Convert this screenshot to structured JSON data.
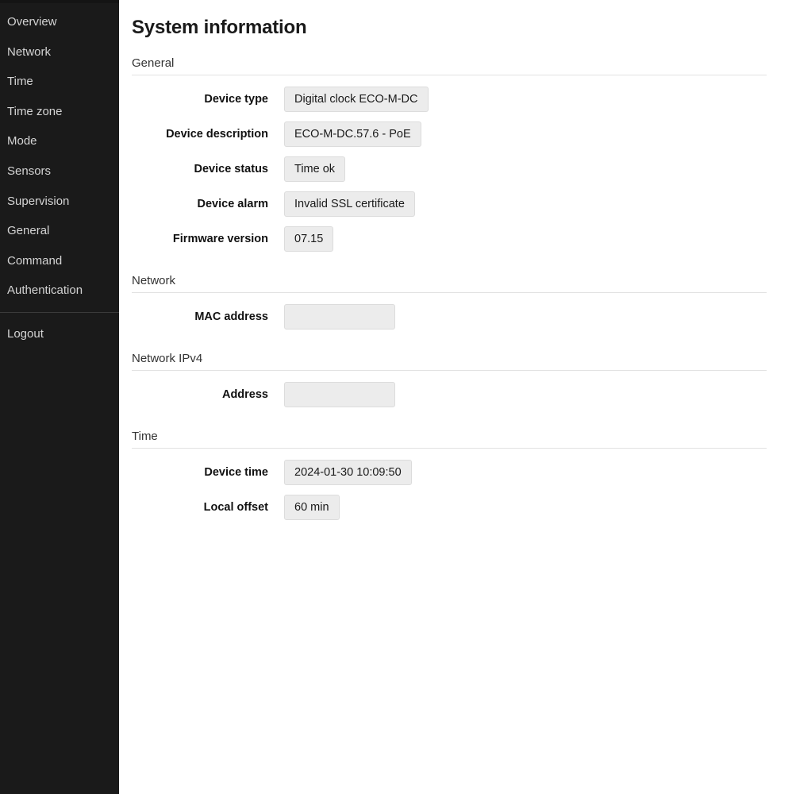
{
  "sidebar": {
    "items": [
      {
        "label": "Overview",
        "name": "sidebar-item-overview"
      },
      {
        "label": "Network",
        "name": "sidebar-item-network"
      },
      {
        "label": "Time",
        "name": "sidebar-item-time"
      },
      {
        "label": "Time zone",
        "name": "sidebar-item-time-zone"
      },
      {
        "label": "Mode",
        "name": "sidebar-item-mode"
      },
      {
        "label": "Sensors",
        "name": "sidebar-item-sensors"
      },
      {
        "label": "Supervision",
        "name": "sidebar-item-supervision"
      },
      {
        "label": "General",
        "name": "sidebar-item-general"
      },
      {
        "label": "Command",
        "name": "sidebar-item-command"
      },
      {
        "label": "Authentication",
        "name": "sidebar-item-authentication"
      }
    ],
    "logout": {
      "label": "Logout",
      "name": "sidebar-item-logout"
    }
  },
  "main": {
    "title": "System information",
    "sections": [
      {
        "header": "General",
        "fields": [
          {
            "label": "Device type",
            "value": "Digital clock ECO-M-DC"
          },
          {
            "label": "Device description",
            "value": "ECO-M-DC.57.6 - PoE"
          },
          {
            "label": "Device status",
            "value": "Time ok"
          },
          {
            "label": "Device alarm",
            "value": "Invalid SSL certificate"
          },
          {
            "label": "Firmware version",
            "value": "07.15"
          }
        ]
      },
      {
        "header": "Network",
        "fields": [
          {
            "label": "MAC address",
            "value": ""
          }
        ]
      },
      {
        "header": "Network IPv4",
        "fields": [
          {
            "label": "Address",
            "value": ""
          }
        ]
      },
      {
        "header": "Time",
        "fields": [
          {
            "label": "Device time",
            "value": "2024-01-30 10:09:50"
          },
          {
            "label": "Local offset",
            "value": "60 min"
          }
        ]
      }
    ]
  },
  "colors": {
    "sidebar_bg": "#1a1a1a",
    "sidebar_text": "#d4d4d4",
    "field_bg": "#ececec",
    "field_border": "#dcdcdc",
    "rule": "#e2e2e2",
    "page_bg": "#ffffff"
  }
}
